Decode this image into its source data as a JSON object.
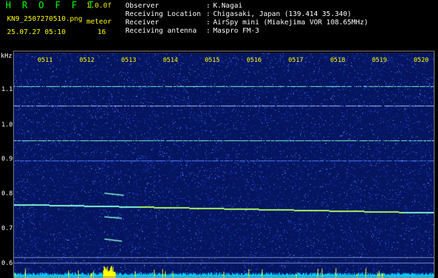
{
  "header": {
    "app_name": "H R O F F T",
    "version": "1.0.0f",
    "filename": "KN9_2507270510.png",
    "mode": "meteor",
    "count": "16",
    "timestamp": "25.07.27 05:10",
    "info": [
      {
        "label": "Observer",
        "value": "K.Nagai"
      },
      {
        "label": "Receiving Location",
        "value": "Chigasaki, Japan (139.414 35.340)"
      },
      {
        "label": "Receiver",
        "value": "AirSpy mini (Miakejima VOR 108.65MHz)"
      },
      {
        "label": "Receiving antenna",
        "value": "Maspro FM-3"
      }
    ],
    "separator": ":"
  },
  "spectrogram": {
    "unit_label": "kHz",
    "y_ticks": [
      "1.1",
      "1.0",
      "0.9",
      "0.8",
      "0.7",
      "0.6"
    ],
    "x_ticks": [
      "0511",
      "0512",
      "0513",
      "0514",
      "0515",
      "0516",
      "0517",
      "0518",
      "0519",
      "0520"
    ],
    "colors": {
      "background": "#051560",
      "noise": "#2a5aff",
      "signal": "#7fffd4",
      "carrier": "#b0ff60",
      "bottom_bar": "#00c8ff",
      "burst": "#ffff00"
    }
  }
}
